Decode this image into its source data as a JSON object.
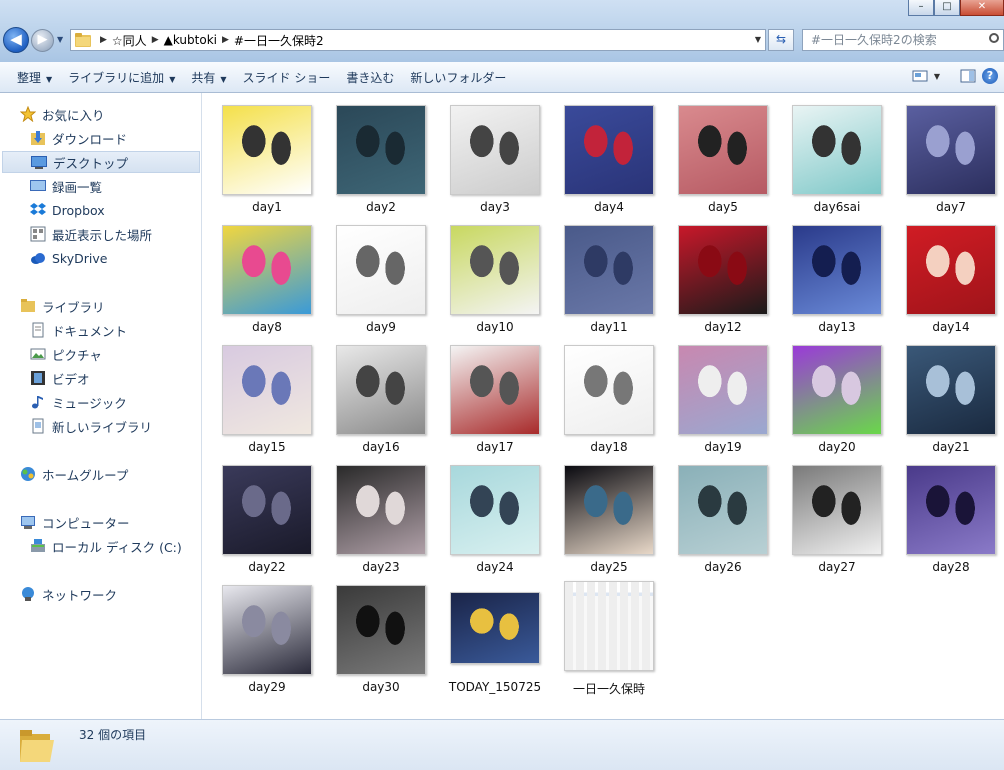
{
  "window": {
    "controls": [
      "–",
      "□",
      "✕"
    ]
  },
  "address": {
    "crumbs": [
      "☆同人",
      "▲kubtoki",
      "#一日一久保時2"
    ]
  },
  "search": {
    "placeholder": "#一日一久保時2の検索"
  },
  "toolbar": {
    "items": [
      {
        "label": "整理",
        "dropdown": true
      },
      {
        "label": "ライブラリに追加",
        "dropdown": true
      },
      {
        "label": "共有",
        "dropdown": true
      },
      {
        "label": "スライド ショー",
        "dropdown": false
      },
      {
        "label": "書き込む",
        "dropdown": false
      },
      {
        "label": "新しいフォルダー",
        "dropdown": false
      }
    ]
  },
  "sidebar": {
    "favorites": {
      "header": "お気に入り",
      "items": [
        "ダウンロード",
        "デスクトップ",
        "録画一覧",
        "Dropbox",
        "最近表示した場所",
        "SkyDrive"
      ]
    },
    "libraries": {
      "header": "ライブラリ",
      "items": [
        "ドキュメント",
        "ピクチャ",
        "ビデオ",
        "ミュージック",
        "新しいライブラリ"
      ]
    },
    "homegroup": "ホームグループ",
    "computer": {
      "header": "コンピューター",
      "items": [
        "ローカル ディスク (C:)"
      ]
    },
    "network": "ネットワーク",
    "selected": "デスクトップ"
  },
  "files": [
    {
      "name": "day1",
      "colors": [
        "#f4e04a",
        "#ffffff",
        "#333333"
      ]
    },
    {
      "name": "day2",
      "colors": [
        "#2b4858",
        "#3e6676",
        "#1a2a33"
      ]
    },
    {
      "name": "day3",
      "colors": [
        "#f2f2f2",
        "#cccccc",
        "#444444"
      ]
    },
    {
      "name": "day4",
      "colors": [
        "#3a4a9a",
        "#2a3478",
        "#c2233a"
      ]
    },
    {
      "name": "day5",
      "colors": [
        "#d98a8e",
        "#b65a63",
        "#222222"
      ]
    },
    {
      "name": "day6sai",
      "colors": [
        "#e9f4f4",
        "#7ec8c8",
        "#333333"
      ]
    },
    {
      "name": "day7",
      "colors": [
        "#5a5fa0",
        "#2c2f5e",
        "#9aa0d0"
      ]
    },
    {
      "name": "day8",
      "colors": [
        "#f0d640",
        "#3a9ad8",
        "#e84a90"
      ]
    },
    {
      "name": "day9",
      "colors": [
        "#ffffff",
        "#eeeeee",
        "#666666"
      ]
    },
    {
      "name": "day10",
      "colors": [
        "#c8d860",
        "#f4f4f4",
        "#555555"
      ]
    },
    {
      "name": "day11",
      "colors": [
        "#4a5a8a",
        "#6a78a8",
        "#2e3a64"
      ]
    },
    {
      "name": "day12",
      "colors": [
        "#c8182a",
        "#1a1a1a",
        "#8a0a14"
      ]
    },
    {
      "name": "day13",
      "colors": [
        "#2a3a8a",
        "#6a8ad8",
        "#141e50"
      ]
    },
    {
      "name": "day14",
      "colors": [
        "#d01c24",
        "#a0141a",
        "#f4d0c0"
      ]
    },
    {
      "name": "day15",
      "colors": [
        "#d8cae0",
        "#f0e8e0",
        "#6a78b8"
      ]
    },
    {
      "name": "day16",
      "colors": [
        "#e8e8e8",
        "#8a8a8a",
        "#444444"
      ]
    },
    {
      "name": "day17",
      "colors": [
        "#f4f4f4",
        "#a82a2a",
        "#555555"
      ]
    },
    {
      "name": "day18",
      "colors": [
        "#ffffff",
        "#eeeeee",
        "#777777"
      ]
    },
    {
      "name": "day19",
      "colors": [
        "#c888b0",
        "#9aa8d0",
        "#eeeeee"
      ]
    },
    {
      "name": "day20",
      "colors": [
        "#9a3ad8",
        "#6ad84a",
        "#d8c8e0"
      ]
    },
    {
      "name": "day21",
      "colors": [
        "#3a5878",
        "#1a2a40",
        "#a8c0d8"
      ]
    },
    {
      "name": "day22",
      "colors": [
        "#3a3a5a",
        "#1a1a2a",
        "#6a6a8a"
      ]
    },
    {
      "name": "day23",
      "colors": [
        "#2a2a2a",
        "#b0a0a8",
        "#e0d8d8"
      ]
    },
    {
      "name": "day24",
      "colors": [
        "#a8d8dc",
        "#d8f0f0",
        "#334455"
      ]
    },
    {
      "name": "day25",
      "colors": [
        "#0a0a10",
        "#e8d8c8",
        "#3a6a8a"
      ]
    },
    {
      "name": "day26",
      "colors": [
        "#8ab0b8",
        "#b8d0d4",
        "#2a3a40"
      ]
    },
    {
      "name": "day27",
      "colors": [
        "#7a7a7a",
        "#f0f0f0",
        "#222222"
      ]
    },
    {
      "name": "day28",
      "colors": [
        "#4a3a8a",
        "#8a7ac8",
        "#1a1438"
      ]
    },
    {
      "name": "day29",
      "colors": [
        "#e8e8ee",
        "#2a2a3a",
        "#8a8aa0"
      ]
    },
    {
      "name": "day30",
      "colors": [
        "#3a3a3a",
        "#7a7a7a",
        "#111111"
      ]
    },
    {
      "name": "TODAY_150725",
      "colors": [
        "#1a2448",
        "#3a5a9a",
        "#e8c040"
      ]
    },
    {
      "name": "一日一久保時",
      "colors": [
        "#f4f4f4",
        "#3a5a9a",
        "#bbbbbb"
      ]
    }
  ],
  "status": {
    "count_text": "32 個の項目"
  },
  "colors": {
    "accent": "#1e395b",
    "selection": "#d5e2f1"
  }
}
